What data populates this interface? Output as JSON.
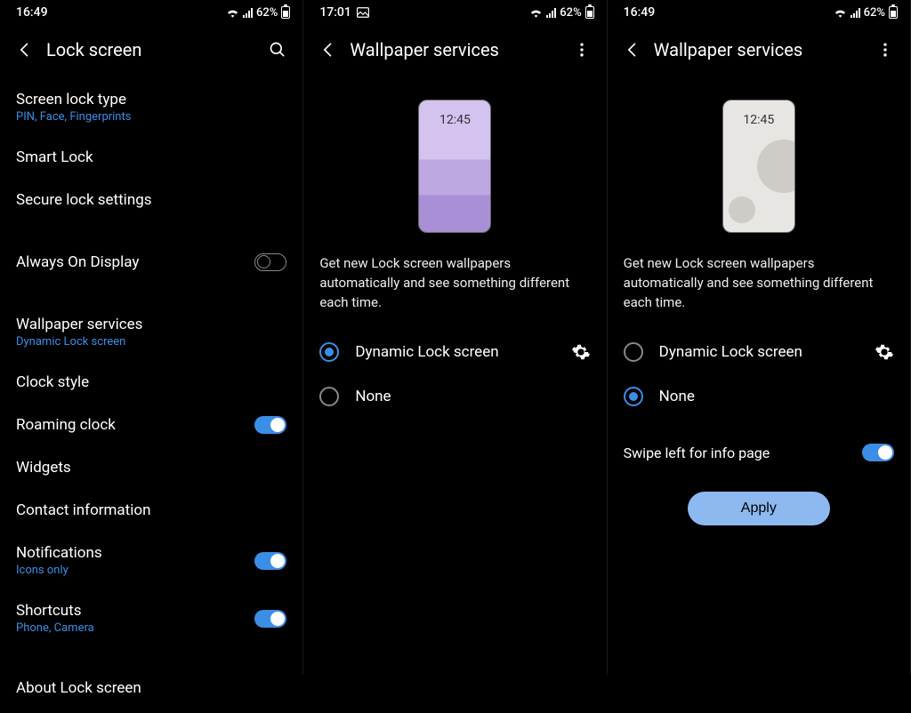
{
  "status": {
    "battery_pct": "62%"
  },
  "panel1": {
    "time": "16:49",
    "title": "Lock screen",
    "items": {
      "lock_type": {
        "title": "Screen lock type",
        "sub": "PIN, Face, Fingerprints"
      },
      "smart_lock": {
        "title": "Smart Lock"
      },
      "secure": {
        "title": "Secure lock settings"
      },
      "aod": {
        "title": "Always On Display"
      },
      "wallpaper": {
        "title": "Wallpaper services",
        "sub": "Dynamic Lock screen"
      },
      "clock_style": {
        "title": "Clock style"
      },
      "roaming": {
        "title": "Roaming clock"
      },
      "widgets": {
        "title": "Widgets"
      },
      "contact": {
        "title": "Contact information"
      },
      "notif": {
        "title": "Notifications",
        "sub": "Icons only"
      },
      "shortcuts": {
        "title": "Shortcuts",
        "sub": "Phone, Camera"
      },
      "about": {
        "title": "About Lock screen"
      }
    }
  },
  "panel2": {
    "time": "17:01",
    "title": "Wallpaper services",
    "preview_time": "12:45",
    "desc": "Get new Lock screen wallpapers automatically and see something different each time.",
    "opts": {
      "dynamic": "Dynamic Lock screen",
      "none": "None"
    }
  },
  "panel3": {
    "time": "16:49",
    "title": "Wallpaper services",
    "preview_time": "12:45",
    "desc": "Get new Lock screen wallpapers automatically and see something different each time.",
    "opts": {
      "dynamic": "Dynamic Lock screen",
      "none": "None"
    },
    "swipe_label": "Swipe left for info page",
    "apply": "Apply"
  }
}
